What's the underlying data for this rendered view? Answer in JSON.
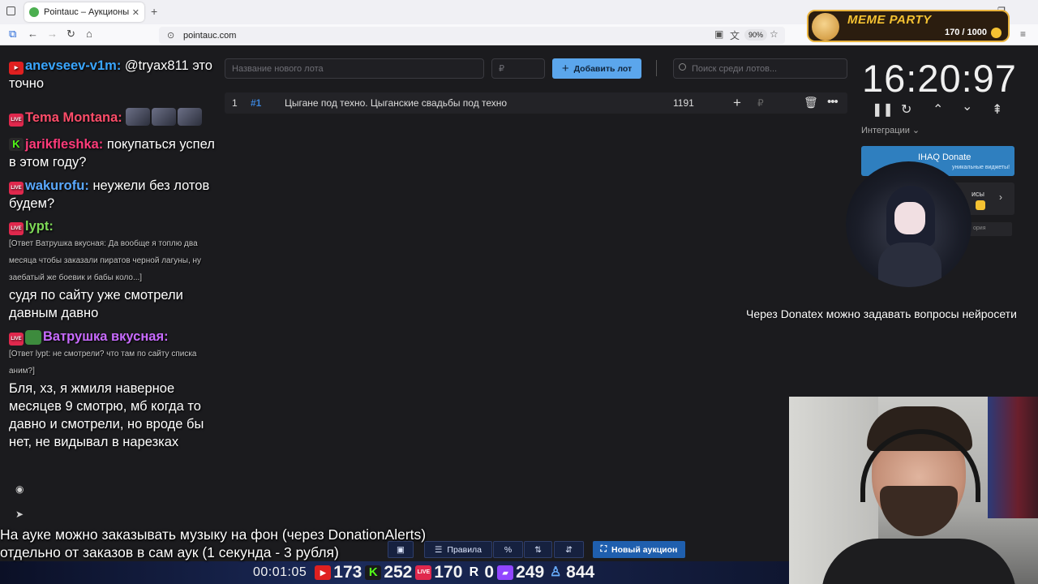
{
  "browser": {
    "tab_title": "Pointauc – Аукционы, лотереи",
    "tab_close": "✕",
    "new_tab": "+",
    "url": "pointauc.com",
    "zoom": "90%"
  },
  "overlay": {
    "meme_title": "MEME PARTY",
    "meme_count": "170 / 1000"
  },
  "app": {
    "lot_name_placeholder": "Название нового лота",
    "amount_placeholder": "₽",
    "add_lot_label": "Добавить лот",
    "search_placeholder": "Поиск среди лотов...",
    "lots": [
      {
        "index": "1",
        "id": "#1",
        "name": "Цыгане под техно. Цыганские свадьбы под техно",
        "amount": "1191",
        "currency": "₽"
      }
    ],
    "timer": "16:20:97",
    "integrations_label": "Интеграции",
    "ihaq_title": "IHAQ Donate",
    "ihaq_subtitle": "уникальные виджеты!",
    "card_text": "исы",
    "card_small": "ория"
  },
  "donatex_text": "Через Donatex можно задавать вопросы нейросети",
  "chat": {
    "messages": [
      {
        "nick": "anevseev-v1m:",
        "text": "@tryax811 это точно",
        "nick_color": "#3aa6ff"
      },
      {
        "nick": "Tema Montana:",
        "text": "",
        "nick_color": "#ff4d6a"
      },
      {
        "nick": "jarikfleshka:",
        "text": "покупаться успел в этом году?",
        "nick_color": "#ff3b7a"
      },
      {
        "nick": "wakurofu:",
        "text": "неужели без лотов будем?",
        "nick_color": "#5aa8ff"
      },
      {
        "nick": "lypt:",
        "text": "",
        "nick_color": "#7ed957"
      },
      {
        "reply": "[Ответ Ватрушка вкусная: Да вообще я топлю два месяца чтобы заказали пиратов черной лагуны, ну заебатый же боевик и бабы коло...]"
      },
      {
        "text": "судя по сайту уже смотрели давным давно"
      },
      {
        "nick": "Ватрушка вкусная:",
        "nick_color": "#c86bff"
      },
      {
        "reply": "[Ответ lypt: не смотрели? что там по сайту списка аним?]"
      },
      {
        "text": "Бля, хз, я жмиля наверное месяцев 9 смотрю, мб когда то давно и смотрели, но вроде бы нет, не видывал в нарезках"
      }
    ]
  },
  "subtitles": {
    "line1": "На ауке можно заказывать музыку на фон (через DonationAlerts)",
    "line2": "отдельно от заказов в сам аук (1 секунда - 3 рубля)"
  },
  "controls": {
    "rules": "Правила",
    "percent": "%",
    "new_auction": "Новый аукцион"
  },
  "stats": {
    "time": "00:01:05",
    "youtube": "173",
    "kick": "252",
    "live": "170",
    "r": "0",
    "twitch": "249",
    "viewers": "844"
  }
}
